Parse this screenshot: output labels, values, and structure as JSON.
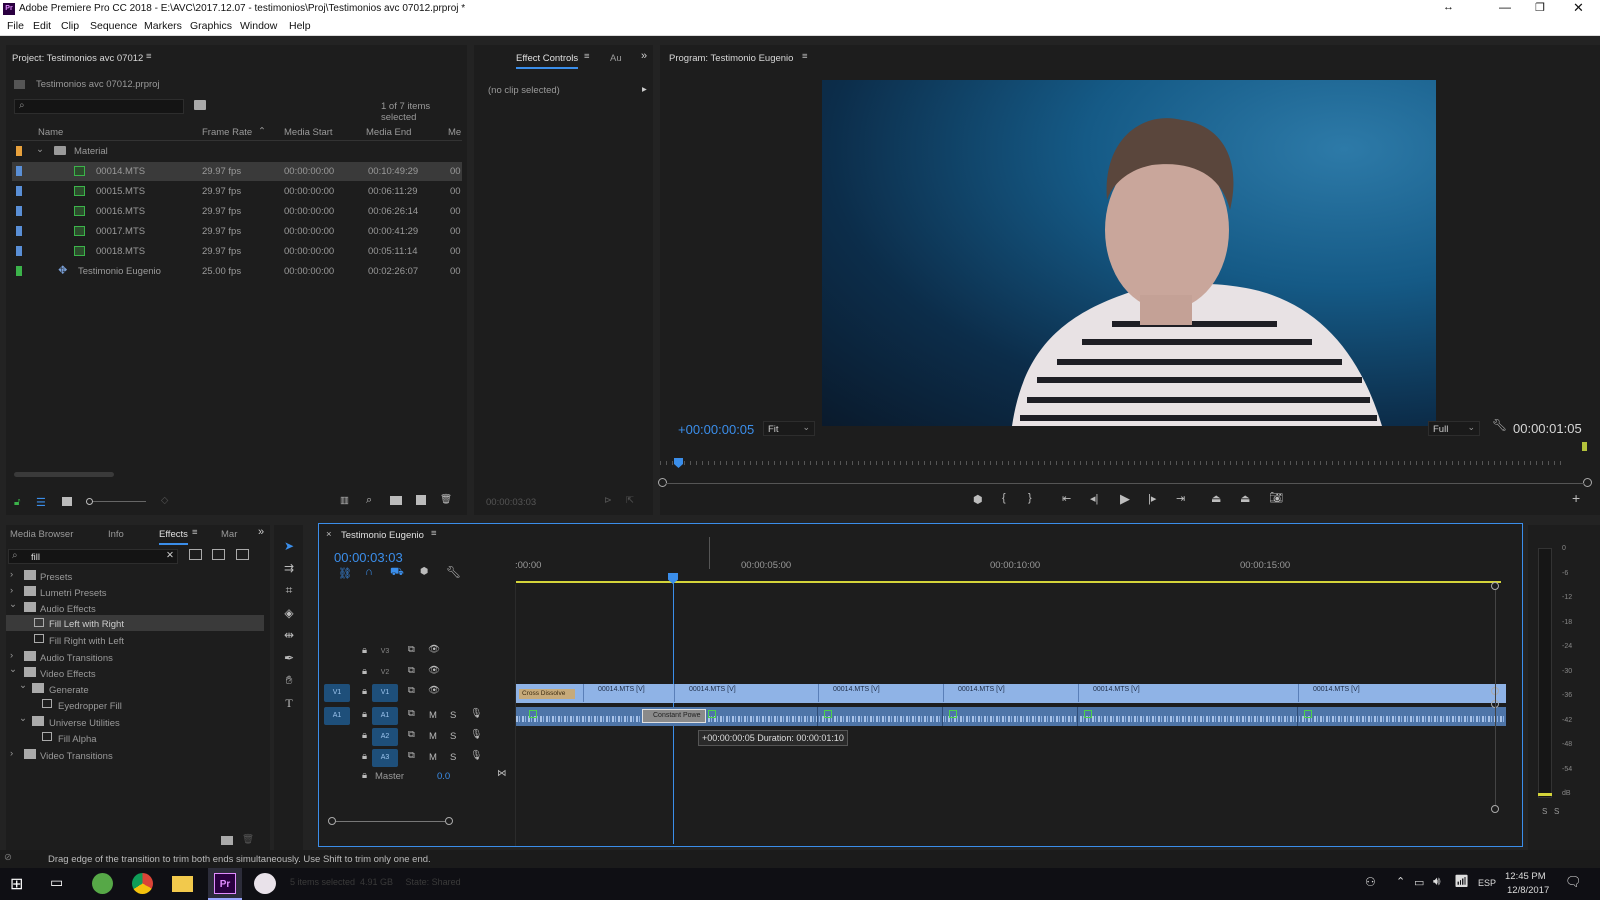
{
  "window": {
    "title": "Adobe Premiere Pro CC 2018 - E:\\AVC\\2017.12.07 - testimonios\\Proj\\Testimonios avc 07012.prproj *",
    "app_icon": "Pr"
  },
  "menu": [
    "File",
    "Edit",
    "Clip",
    "Sequence",
    "Markers",
    "Graphics",
    "Window",
    "Help"
  ],
  "project": {
    "panel_title": "Project: Testimonios avc 07012",
    "file_name": "Testimonios avc 07012.prproj",
    "selection_info": "1 of 7 items selected",
    "columns": [
      "Name",
      "Frame Rate",
      "Media Start",
      "Media End",
      "Me"
    ],
    "folder": "Material",
    "items": [
      {
        "name": "00014.MTS",
        "fps": "29.97 fps",
        "start": "00:00:00:00",
        "end": "00:10:49:29",
        "extra": "00",
        "color": "#5a8fd6"
      },
      {
        "name": "00015.MTS",
        "fps": "29.97 fps",
        "start": "00:00:00:00",
        "end": "00:06:11:29",
        "extra": "00",
        "color": "#5a8fd6"
      },
      {
        "name": "00016.MTS",
        "fps": "29.97 fps",
        "start": "00:00:00:00",
        "end": "00:06:26:14",
        "extra": "00",
        "color": "#5a8fd6"
      },
      {
        "name": "00017.MTS",
        "fps": "29.97 fps",
        "start": "00:00:00:00",
        "end": "00:00:41:29",
        "extra": "00",
        "color": "#5a8fd6"
      },
      {
        "name": "00018.MTS",
        "fps": "29.97 fps",
        "start": "00:00:00:00",
        "end": "00:05:11:14",
        "extra": "00",
        "color": "#5a8fd6"
      },
      {
        "name": "Testimonio Eugenio",
        "fps": "25.00 fps",
        "start": "00:00:00:00",
        "end": "00:02:26:07",
        "extra": "00",
        "color": "#3bb34a"
      }
    ]
  },
  "effect_controls": {
    "tab": "Effect Controls",
    "tab2": "Au",
    "no_clip": "(no clip selected)",
    "timecode": "00:00:03:03"
  },
  "program": {
    "title": "Program: Testimonio Eugenio",
    "timecode": "+00:00:00:05",
    "fit": "Fit",
    "quality": "Full",
    "duration": "00:00:01:05"
  },
  "effects_panel": {
    "tabs": [
      "Media Browser",
      "Info",
      "Effects",
      "Mar"
    ],
    "search": "fill",
    "tree": [
      {
        "label": "Presets",
        "level": 0,
        "type": "folder",
        "open": false
      },
      {
        "label": "Lumetri Presets",
        "level": 0,
        "type": "folder",
        "open": false
      },
      {
        "label": "Audio Effects",
        "level": 0,
        "type": "folder",
        "open": true
      },
      {
        "label": "Fill Left with Right",
        "level": 1,
        "type": "effect",
        "selected": true
      },
      {
        "label": "Fill Right with Left",
        "level": 1,
        "type": "effect"
      },
      {
        "label": "Audio Transitions",
        "level": 0,
        "type": "folder",
        "open": false
      },
      {
        "label": "Video Effects",
        "level": 0,
        "type": "folder",
        "open": true
      },
      {
        "label": "Generate",
        "level": 1,
        "type": "folder",
        "open": true
      },
      {
        "label": "Eyedropper Fill",
        "level": 2,
        "type": "effect"
      },
      {
        "label": "Universe Utilities",
        "level": 1,
        "type": "folder",
        "open": true
      },
      {
        "label": "Fill Alpha",
        "level": 2,
        "type": "effect"
      },
      {
        "label": "Video Transitions",
        "level": 0,
        "type": "folder",
        "open": false
      }
    ]
  },
  "timeline": {
    "sequence": "Testimonio Eugenio",
    "timecode": "00:00:03:03",
    "ruler": [
      ":00:00",
      "00:00:05:00",
      "00:00:10:00",
      "00:00:15:00"
    ],
    "video_tracks": [
      "V3",
      "V2",
      "V1"
    ],
    "audio_tracks": [
      "A1",
      "A2",
      "A3"
    ],
    "master_label": "Master",
    "master_value": "0.0",
    "transition_label": "Cross Dissolve",
    "audio_transition_label": "Constant Powe",
    "clip_name": "00014.MTS [V]",
    "tooltip": "+00:00:00:05 Duration: 00:00:01:10",
    "mute": "M",
    "solo": "S"
  },
  "meter": {
    "scale": [
      "0",
      "-6",
      "-12",
      "-18",
      "-24",
      "-30",
      "-36",
      "-42",
      "-48",
      "-54",
      "dB"
    ],
    "solo_labels": [
      "S",
      "S"
    ]
  },
  "status": {
    "message": "Drag edge of the transition to trim both ends simultaneously. Use Shift to trim only one end."
  },
  "taskbar": {
    "language": "ESP",
    "time": "12:45 PM",
    "date": "12/8/2017",
    "faded_text": "5 items selected  4.91 GB     State: Shared"
  }
}
